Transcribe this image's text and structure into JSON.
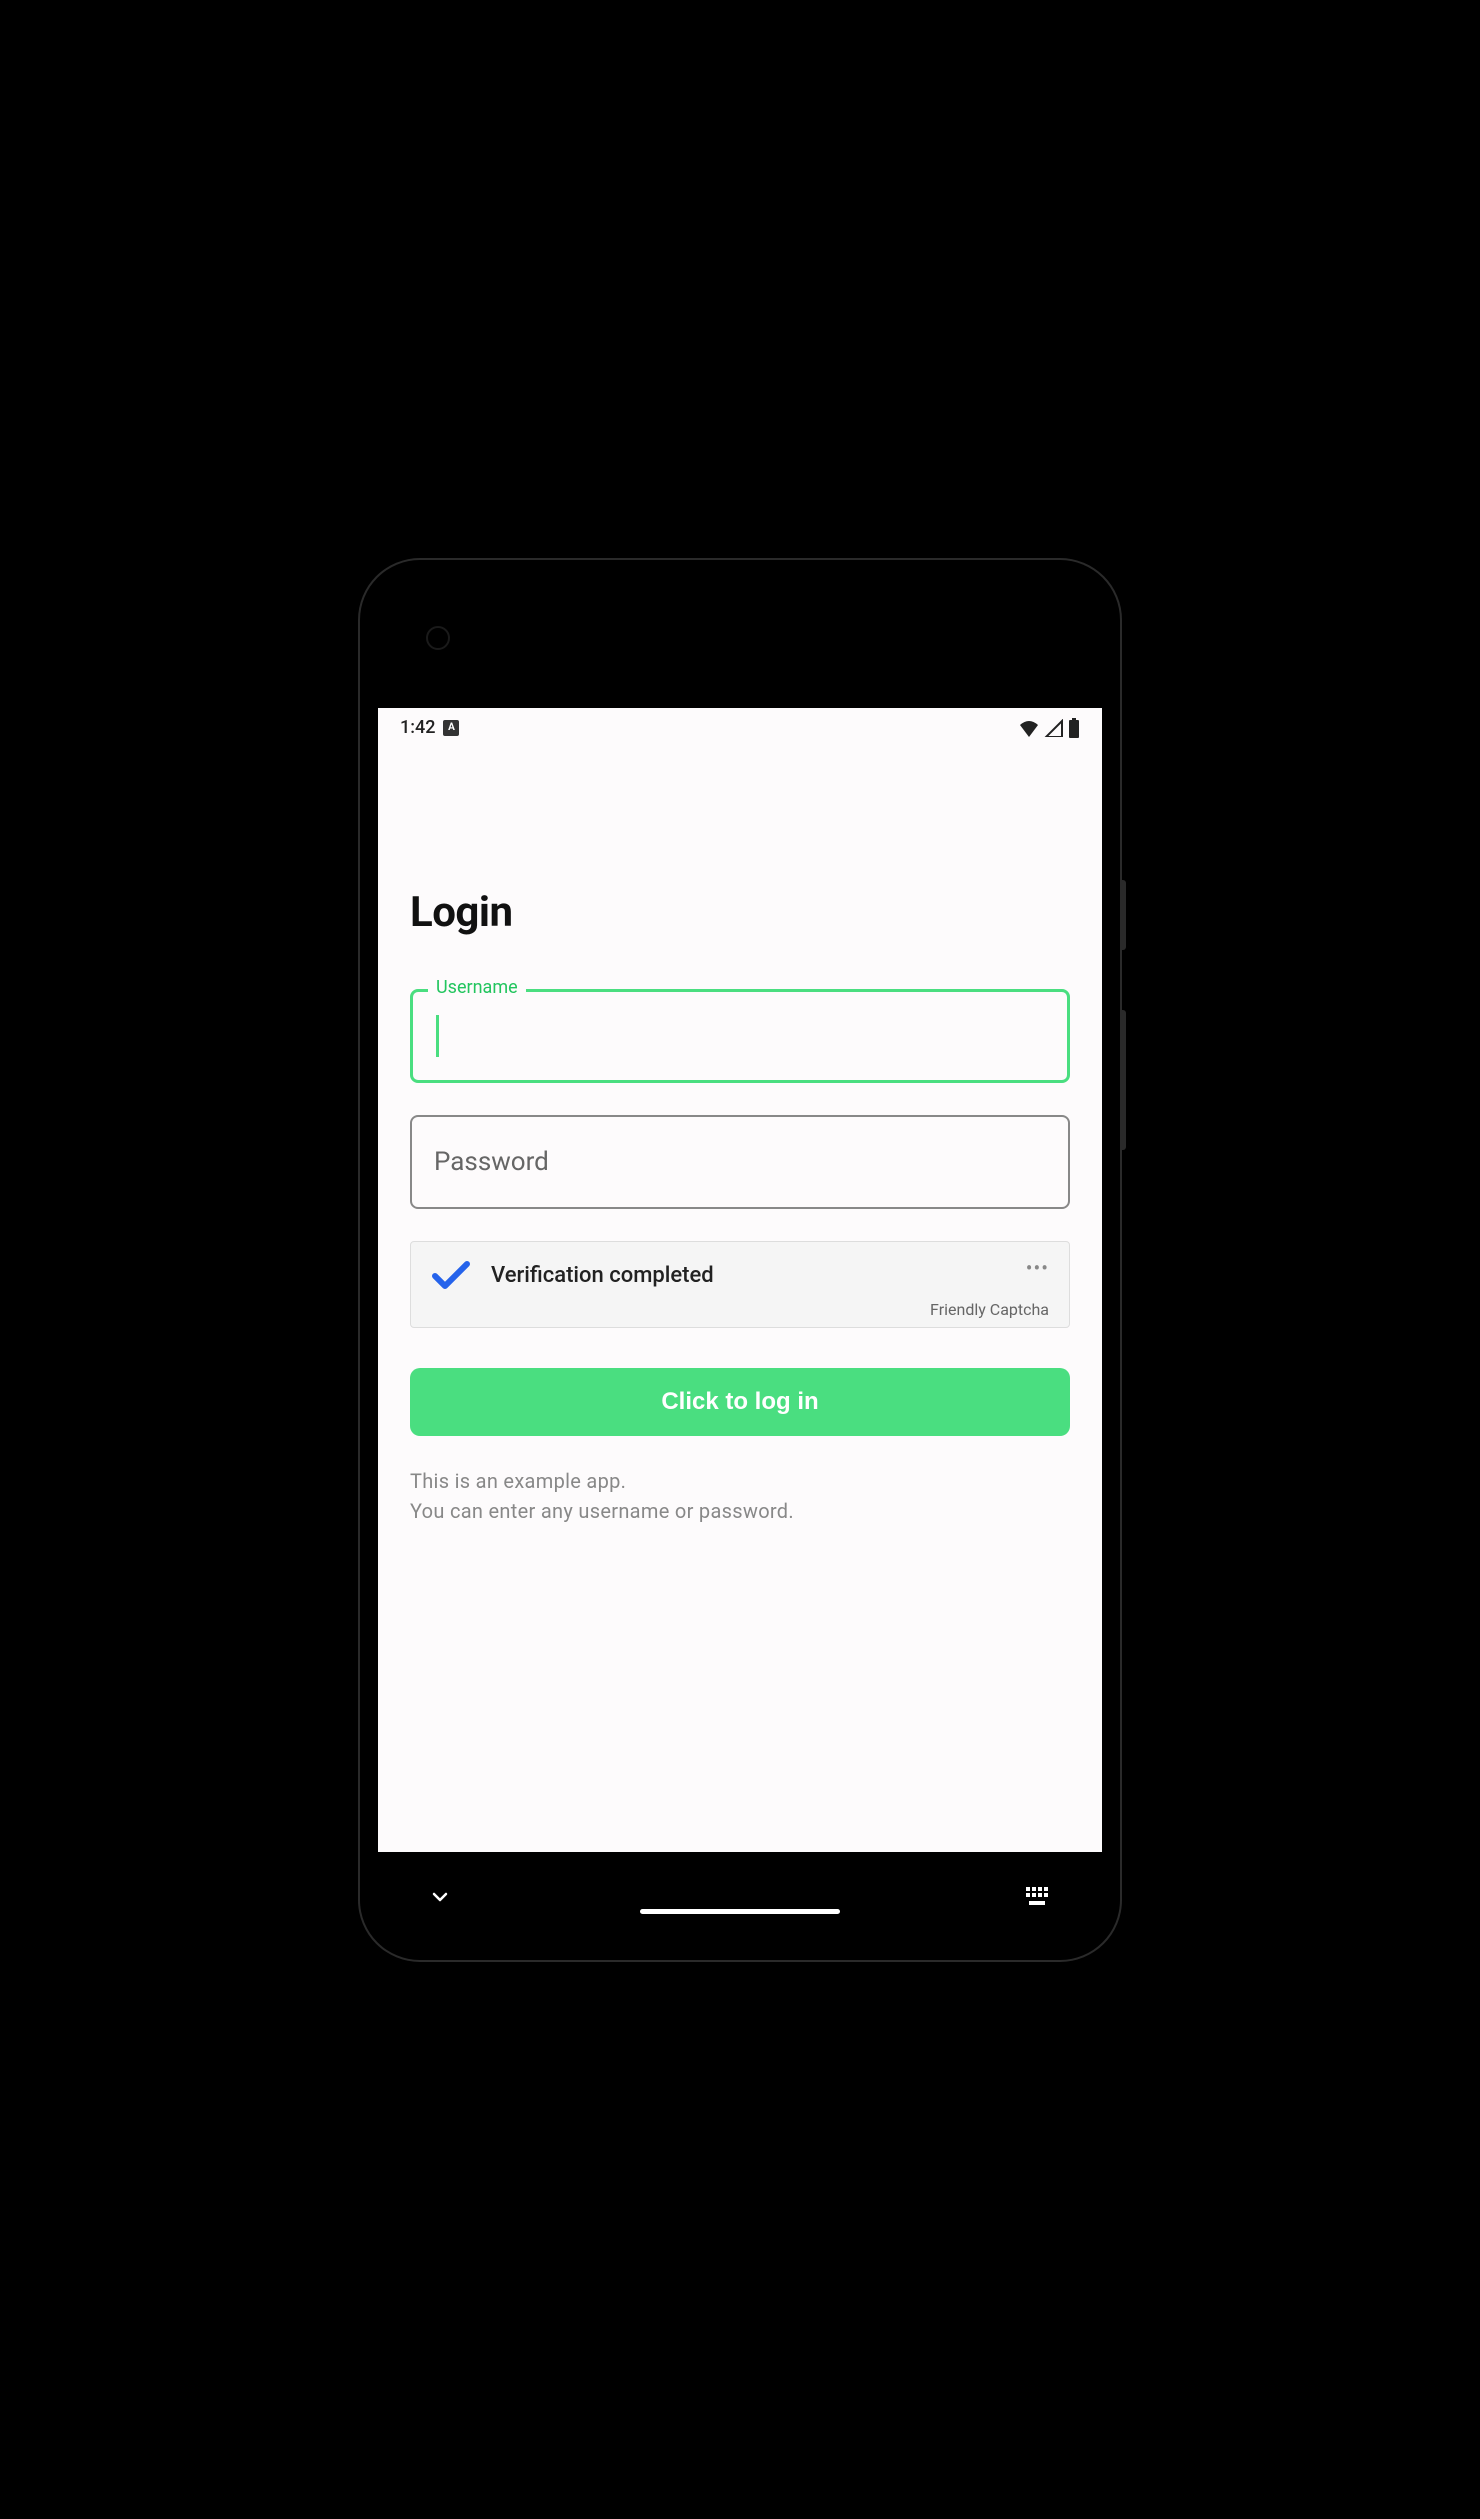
{
  "statusBar": {
    "time": "1:42",
    "badge": "A"
  },
  "page": {
    "title": "Login"
  },
  "form": {
    "username": {
      "label": "Username",
      "value": ""
    },
    "password": {
      "label": "Password",
      "value": ""
    }
  },
  "captcha": {
    "status": "Verification completed",
    "brand": "Friendly Captcha",
    "dots": "•••"
  },
  "button": {
    "login": "Click to log in"
  },
  "hint": {
    "line1": "This is an example app.",
    "line2": "You can enter any username or password."
  }
}
